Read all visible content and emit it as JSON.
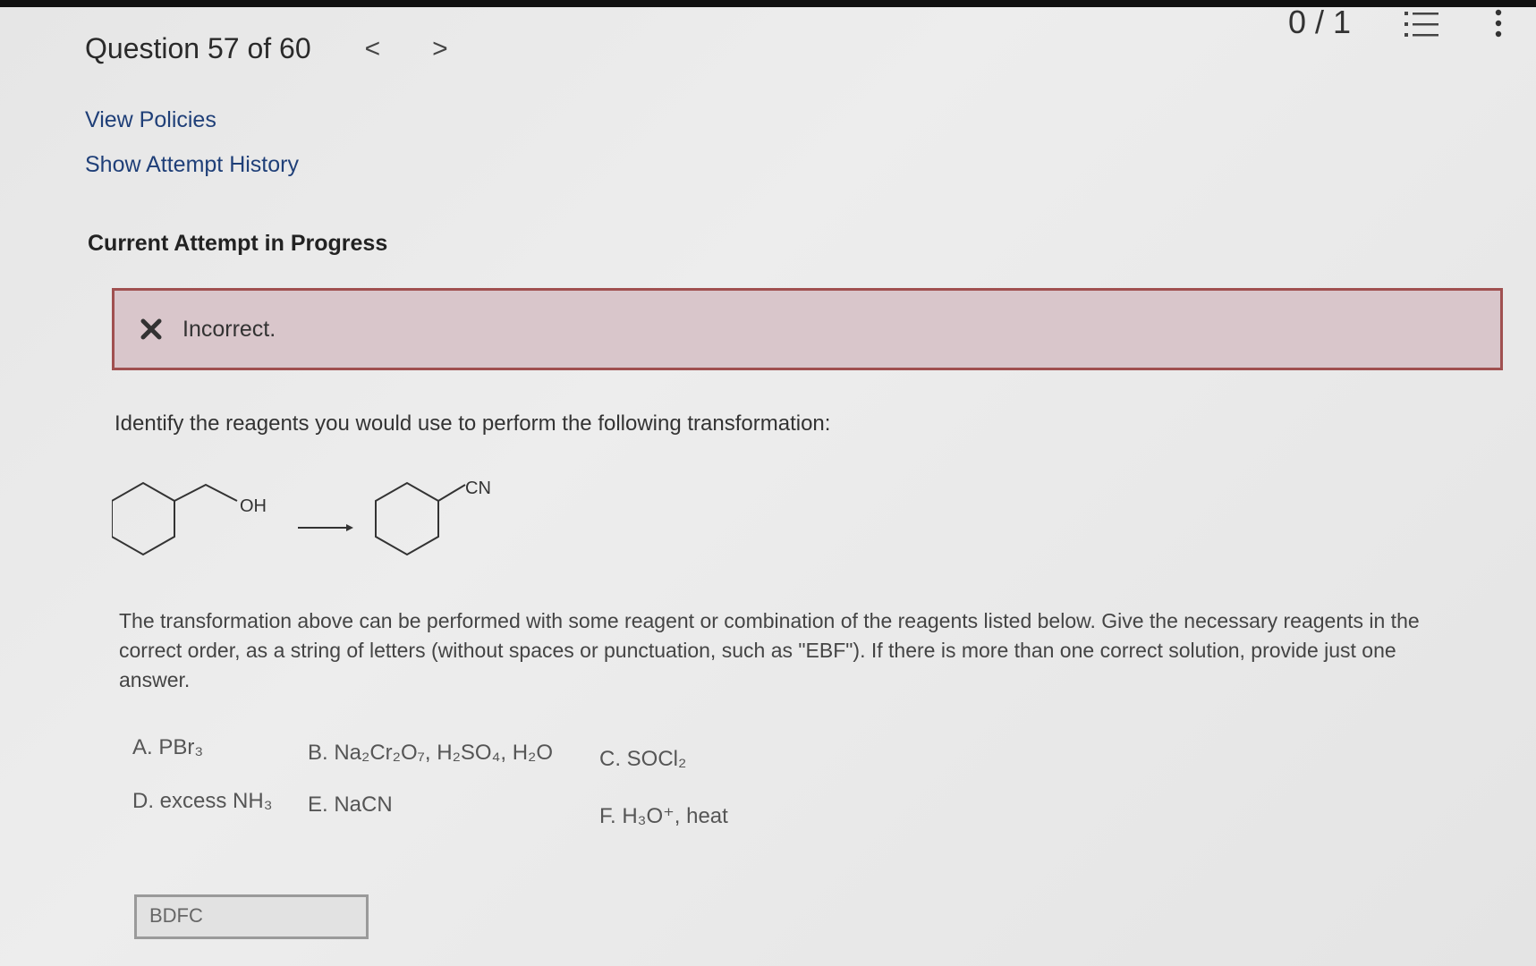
{
  "header": {
    "question_label": "Question 57 of 60",
    "prev_arrow": "<",
    "next_arrow": ">",
    "score": "0 / 1"
  },
  "links": {
    "view_policies": "View Policies",
    "show_attempt_history": "Show Attempt History"
  },
  "attempt": {
    "heading": "Current Attempt in Progress",
    "feedback_text": "Incorrect."
  },
  "question": {
    "prompt": "Identify the reagents you would use to perform the following transformation:",
    "reactant_label": "OH",
    "product_label": "CN",
    "instructions": "The transformation above can be performed with some reagent or combination of the reagents listed below. Give the necessary reagents in the correct order, as a string of letters (without spaces or punctuation, such as \"EBF\"). If there is more than one correct solution, provide just one answer."
  },
  "options": {
    "a": "A. PBr₃",
    "b": "B. Na₂Cr₂O₇, H₂SO₄, H₂O",
    "c": "C. SOCl₂",
    "d": "D. excess NH₃",
    "e": "E. NaCN",
    "f": "F. H₃O⁺, heat"
  },
  "answer": {
    "value": "BDFC"
  },
  "colors": {
    "feedback_bg": "#d9c6cb",
    "feedback_border": "#a05050",
    "link": "#1f3f78"
  }
}
